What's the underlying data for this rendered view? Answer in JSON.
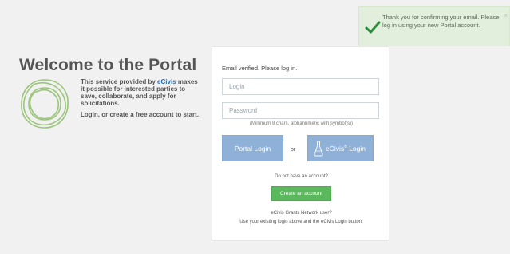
{
  "toast": {
    "message": "Thank you for confirming your email. Please log in using your new Portal account.",
    "close": "×",
    "color": "#e2efdc",
    "icon": "check-icon"
  },
  "intro": {
    "title": "Welcome to the Portal",
    "text_before_brand": "This service provided by ",
    "brand": "eCivis",
    "text_after_brand": " makes it possible for interested parties to save, collaborate, and apply for solicitations.",
    "cta": "Login, or create a free account to start.",
    "logo_icon": "ecivis-ring-logo"
  },
  "login": {
    "status": "Email verified. Please log in.",
    "login_placeholder": "Login",
    "password_placeholder": "Password",
    "password_hint": "(Minimum 8 chars, alphanumeric with symbol(s))",
    "portal_button": "Portal Login",
    "or": "or",
    "ecivis_button": "eCivis",
    "ecivis_reg": "®",
    "ecivis_button_suffix": " Login",
    "no_account": "Do not have an account?",
    "create_button": "Create an account",
    "network_question": "eCivis Grants Network user?",
    "network_hint": "Use your existing login above and the eCivis Login button.",
    "button_color": "#8fb1d8",
    "create_color": "#5cb85c"
  }
}
